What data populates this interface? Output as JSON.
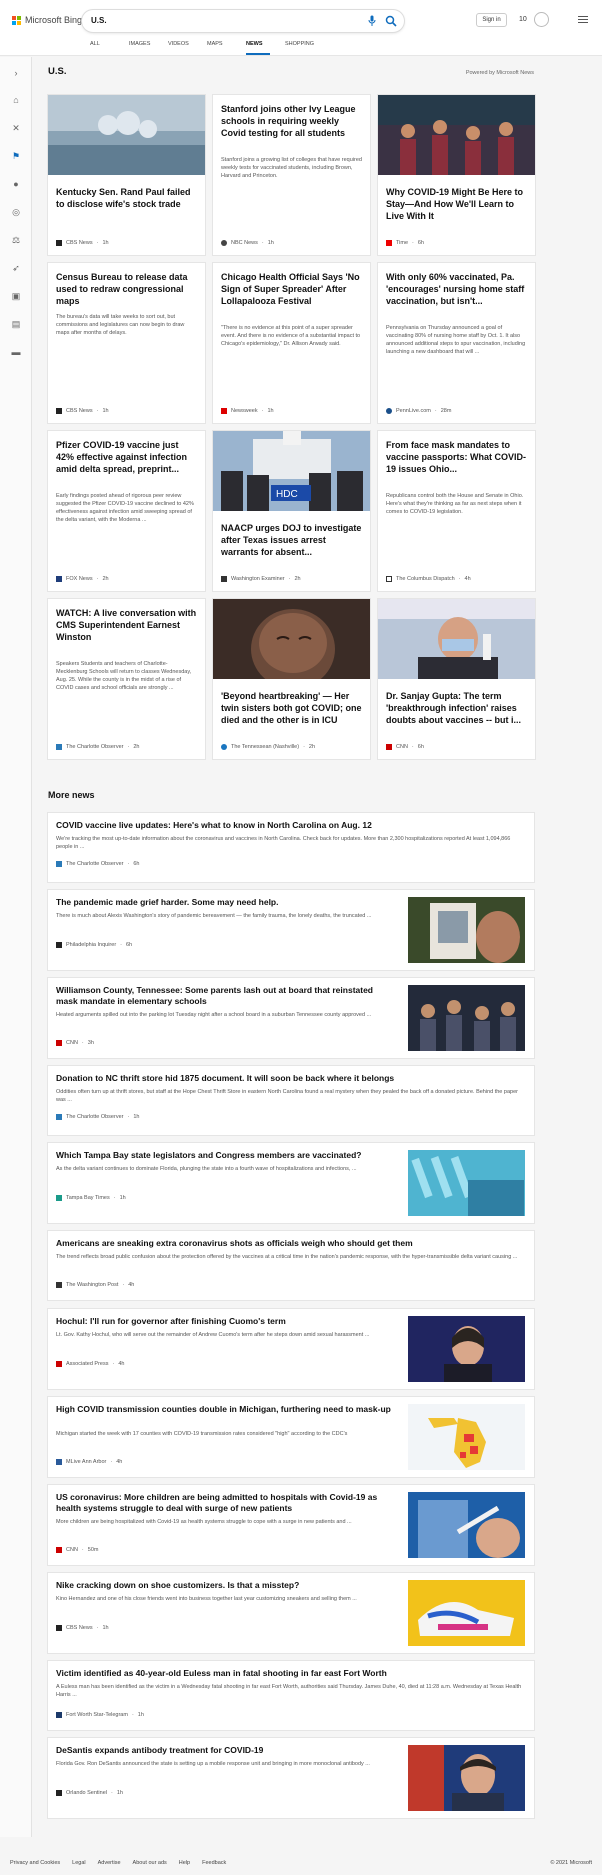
{
  "header": {
    "brand": "Microsoft Bing",
    "query": "U.S.",
    "signin": "Sign in",
    "points": "10"
  },
  "tabs": [
    "ALL",
    "IMAGES",
    "VIDEOS",
    "MAPS",
    "NEWS",
    "SHOPPING"
  ],
  "section": {
    "title": "U.S.",
    "powered": "Powered by Microsoft News"
  },
  "cards": [
    {
      "title": "Kentucky Sen. Rand Paul failed to disclose wife's stock trade",
      "snippet": "",
      "source": "CBS News",
      "time": "1h"
    },
    {
      "title": "Stanford joins other Ivy League schools in requiring weekly Covid testing for all students",
      "snippet": "Stanford joins a growing list of colleges that have required weekly tests for vaccinated students, including Brown, Harvard and Princeton.",
      "source": "NBC News",
      "time": "1h"
    },
    {
      "title": "Why COVID-19 Might Be Here to Stay—And How We'll Learn to Live With It",
      "snippet": "",
      "source": "Time",
      "time": "6h"
    },
    {
      "title": "Census Bureau to release data used to redraw congressional maps",
      "snippet": "The bureau's data will take weeks to sort out, but commissions and legislatures can now begin to draw maps after months of delays.",
      "source": "CBS News",
      "time": "1h"
    },
    {
      "title": "Chicago Health Official Says 'No Sign of Super Spreader' After Lollapalooza Festival",
      "snippet": "\"There is no evidence at this point of a super spreader event. And there is no evidence of a substantial impact to Chicago's epidemiology,\" Dr. Allison Arwady said.",
      "source": "Newsweek",
      "time": "1h"
    },
    {
      "title": "With only 60% vaccinated, Pa. 'encourages' nursing home staff vaccination, but isn't...",
      "snippet": "Pennsylvania on Thursday announced a goal of vaccinating 80% of nursing home staff by Oct. 1. It also announced additional steps to spur vaccination, including launching a new dashboard that will ...",
      "source": "PennLive.com",
      "time": "28m"
    },
    {
      "title": "Pfizer COVID-19 vaccine just 42% effective against infection amid delta spread, preprint...",
      "snippet": "Early findings posted ahead of rigorous peer review suggested the Pfizer COVID-19 vaccine declined to 42% effectiveness against infection amid sweeping spread of the delta variant, with the Moderna ...",
      "source": "FOX News",
      "time": "2h"
    },
    {
      "title": "NAACP urges DOJ to investigate after Texas issues arrest warrants for absent...",
      "snippet": "",
      "source": "Washington Examiner",
      "time": "2h"
    },
    {
      "title": "From face mask mandates to vaccine passports: What COVID-19 issues Ohio...",
      "snippet": "Republicans control both the House and Senate in Ohio. Here's what they're thinking as far as next steps when it comes to COVID-19 legislation.",
      "source": "The Columbus Dispatch",
      "time": "4h"
    },
    {
      "title": "WATCH: A live conversation with CMS Superintendent Earnest Winston",
      "snippet": "Speakers Students and teachers of Charlotte-Mecklenburg Schools will return to classes Wednesday, Aug. 25. While the county is in the midst of a rise of COVID cases and school officials are strongly ...",
      "source": "The Charlotte Observer",
      "time": "2h"
    },
    {
      "title": "'Beyond heartbreaking' — Her twin sisters both got COVID; one died and the other is in ICU",
      "snippet": "",
      "source": "The Tennessean (Nashville)",
      "time": "2h"
    },
    {
      "title": "Dr. Sanjay Gupta: The term 'breakthrough infection' raises doubts about vaccines -- but i...",
      "snippet": "",
      "source": "CNN",
      "time": "6h"
    }
  ],
  "more": {
    "title": "More news",
    "items": [
      {
        "title": "COVID vaccine live updates: Here's what to know in North Carolina on Aug. 12",
        "snippet": "We're tracking the most up-to-date information about the coronavirus and vaccines in North Carolina. Check back for updates. More than 2,300 hospitalizations reported At least 1,094,866 people in ...",
        "source": "The Charlotte Observer",
        "time": "6h"
      },
      {
        "title": "The pandemic made grief harder. Some may need help.",
        "snippet": "There is much about Alexis Washington's story of pandemic bereavement — the family trauma, the lonely deaths, the truncated ...",
        "source": "Philadelphia Inquirer",
        "time": "6h"
      },
      {
        "title": "Williamson County, Tennessee: Some parents lash out at board that reinstated mask mandate in elementary schools",
        "snippet": "Heated arguments spilled out into the parking lot Tuesday night after a school board in a suburban Tennessee county approved ...",
        "source": "CNN",
        "time": "3h"
      },
      {
        "title": "Donation to NC thrift store hid 1875 document. It will soon be back where it belongs",
        "snippet": "Oddities often turn up at thrift stores, but staff at the Hope Chest Thrift Store in eastern North Carolina found a real mystery when they pealed the back off a donated picture. Behind the paper was ...",
        "source": "The Charlotte Observer",
        "time": "1h"
      },
      {
        "title": "Which Tampa Bay state legislators and Congress members are vaccinated?",
        "snippet": "As the delta variant continues to dominate Florida, plunging the state into a fourth wave of hospitalizations and infections, ...",
        "source": "Tampa Bay Times",
        "time": "1h"
      },
      {
        "title": "Americans are sneaking extra coronavirus shots as officials weigh who should get them",
        "snippet": "The trend reflects broad public confusion about the protection offered by the vaccines at a critical time in the nation's pandemic response, with the hyper-transmissible delta variant causing ...",
        "source": "The Washington Post",
        "time": "4h"
      },
      {
        "title": "Hochul: I'll run for governor after finishing Cuomo's term",
        "snippet": "Lt. Gov. Kathy Hochul, who will serve out the remainder of Andrew Cuomo's term after he steps down amid sexual harassment ...",
        "source": "Associated Press",
        "time": "4h"
      },
      {
        "title": "High COVID transmission counties double in Michigan, furthering need to mask-up",
        "snippet": "Michigan started the week with 17 counties with COVID-19 transmission rates considered \"high\" according to the CDC's",
        "source": "MLive Ann Arbor",
        "time": "4h"
      },
      {
        "title": "US coronavirus: More children are being admitted to hospitals with Covid-19 as health systems struggle to deal with surge of new patients",
        "snippet": "More children are being hospitalized with Covid-19 as health systems struggle to cope with a surge in new patients and ...",
        "source": "CNN",
        "time": "50m"
      },
      {
        "title": "Nike cracking down on shoe customizers. Is that a misstep?",
        "snippet": "Kino Hernandez and one of his close friends went into business together last year customizing sneakers and selling them ...",
        "source": "CBS News",
        "time": "1h"
      },
      {
        "title": "Victim identified as 40-year-old Euless man in fatal shooting in far east Fort Worth",
        "snippet": "A Euless man has been identified as the victim in a Wednesday fatal shooting in far east Fort Worth, authorities said Thursday. James Duhe, 40, died at 11:28 a.m. Wednesday at Texas Health Harris ...",
        "source": "Fort Worth Star-Telegram",
        "time": "1h"
      },
      {
        "title": "DeSantis expands antibody treatment for COVID-19",
        "snippet": "Florida Gov. Ron DeSantis announced the state is setting up a mobile response unit and bringing in more monoclonal antibody ...",
        "source": "Orlando Sentinel",
        "time": "1h"
      }
    ]
  },
  "footer": {
    "links": [
      "Privacy and Cookies",
      "Legal",
      "Advertise",
      "About our ads",
      "Help",
      "Feedback"
    ],
    "copyright": "© 2021 Microsoft"
  },
  "colors": {
    "accent": "#0f6cbd",
    "cnn": "#cc0000",
    "nbc": "#333"
  }
}
